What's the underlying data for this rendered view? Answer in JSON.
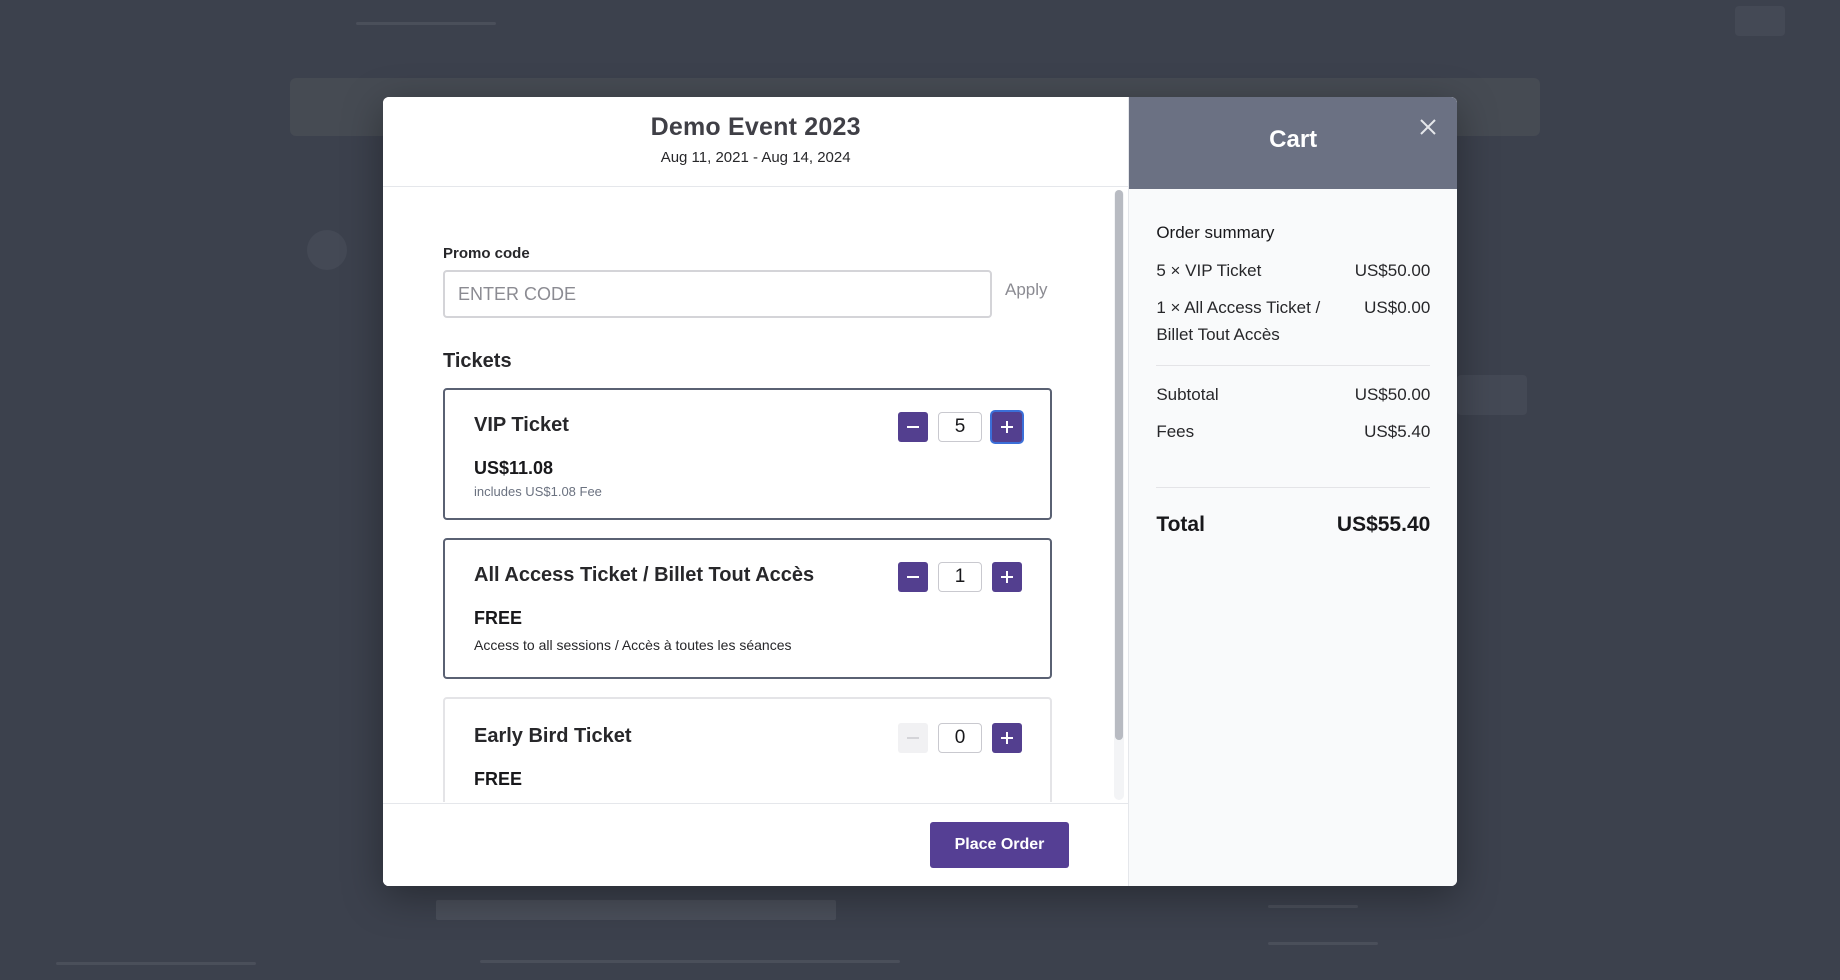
{
  "event": {
    "title": "Demo Event 2023",
    "dates": "Aug 11, 2021 - Aug 14, 2024"
  },
  "promo": {
    "label": "Promo code",
    "placeholder": "ENTER CODE",
    "value": "",
    "apply_label": "Apply"
  },
  "tickets_heading": "Tickets",
  "tickets": [
    {
      "name": "VIP Ticket",
      "price": "US$11.08",
      "note": "includes US$1.08 Fee",
      "quantity": "5"
    },
    {
      "name": "All Access Ticket / Billet Tout Accès",
      "price": "FREE",
      "description": "Access to all sessions / Accès à toutes les séances",
      "quantity": "1"
    },
    {
      "name": "Early Bird Ticket",
      "price": "FREE",
      "quantity": "0"
    }
  ],
  "footer": {
    "place_order_label": "Place Order"
  },
  "cart": {
    "title": "Cart",
    "order_summary_label": "Order summary",
    "items": [
      {
        "label": "5 × VIP Ticket",
        "amount": "US$50.00"
      },
      {
        "label": "1 × All Access Ticket / Billet Tout Accès",
        "amount": "US$0.00"
      }
    ],
    "subtotal_label": "Subtotal",
    "subtotal": "US$50.00",
    "fees_label": "Fees",
    "fees": "US$5.40",
    "total_label": "Total",
    "total": "US$55.40"
  },
  "colors": {
    "accent": "#553f94",
    "cart_header": "#6b7183",
    "overlay": "#3c414d"
  },
  "icons": {
    "close": "close-icon",
    "decrease": "minus-icon",
    "increase": "plus-icon"
  }
}
